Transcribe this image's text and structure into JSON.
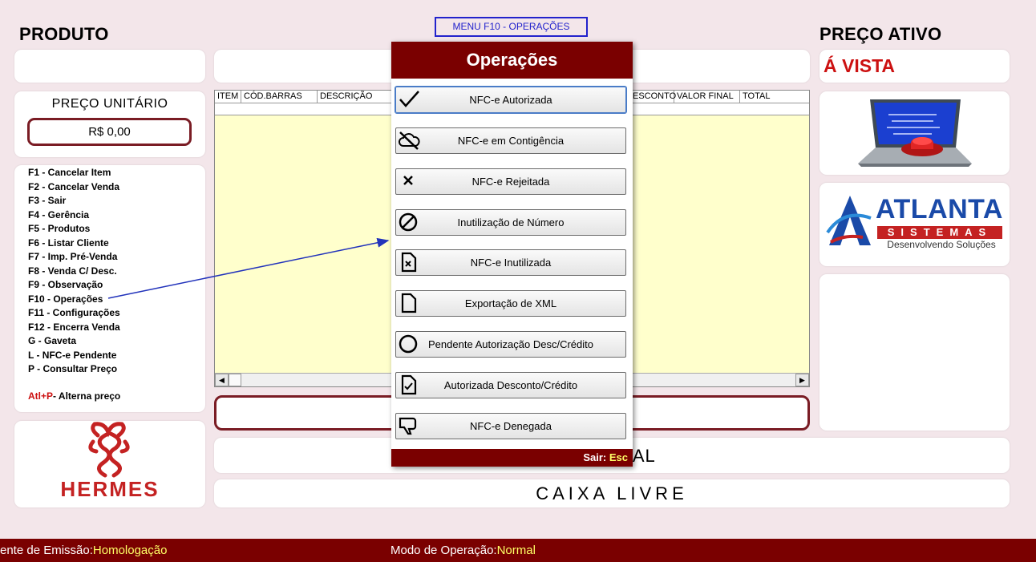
{
  "menu_label": "MENU F10 - OPERAÇÕES",
  "left": {
    "produto_title": "PRODUTO",
    "preco_unitario_title": "PREÇO UNITÁRIO",
    "preco_unitario_value": "R$ 0,00",
    "shortcuts": [
      "F1 - Cancelar Item",
      "F2 - Cancelar Venda",
      "F3 - Sair",
      "F4 - Gerência",
      "F5 - Produtos",
      "F6 - Listar Cliente",
      "F7 - Imp. Pré-Venda",
      "F8 - Venda C/ Desc.",
      "F9 - Observação",
      "F10 - Operações",
      "F11 - Configurações",
      "F12 - Encerra Venda",
      "G - Gaveta",
      "L - NFC-e Pendente",
      "P - Consultar Preço"
    ],
    "alt_key": "Atl+P",
    "alt_text": "- Alterna preço",
    "hermes_logo_text": "HERMES"
  },
  "grid": {
    "columns": [
      "ITEM",
      "CÓD.BARRAS",
      "DESCRIÇÃO",
      "ESCONTO",
      "VALOR FINAL",
      "TOTAL"
    ]
  },
  "center": {
    "valor_final": "OR FINAL",
    "caixa_livre": "CAIXA LIVRE"
  },
  "right": {
    "preco_ativo_title": "PREÇO ATIVO",
    "preco_ativo_value": "Á VISTA",
    "atlanta_name": "ATLANTA",
    "atlanta_sub": "SISTEMAS",
    "atlanta_slogan": "Desenvolvendo Soluções"
  },
  "modal": {
    "title": "Operações",
    "buttons": [
      {
        "label": "NFC-e Autorizada",
        "icon": "check-icon"
      },
      {
        "label": "NFC-e em Contigência",
        "icon": "cloud-off-icon"
      },
      {
        "label": "NFC-e Rejeitada",
        "icon": "x-icon"
      },
      {
        "label": "Inutilização de Número",
        "icon": "ban-icon"
      },
      {
        "label": "NFC-e Inutilizada",
        "icon": "file-x-icon"
      },
      {
        "label": "Exportação de XML",
        "icon": "file-icon"
      },
      {
        "label": "Pendente Autorização Desc/Crédito",
        "icon": "circle-icon"
      },
      {
        "label": "Autorizada Desconto/Crédito",
        "icon": "file-check-icon"
      },
      {
        "label": "NFC-e Denegada",
        "icon": "thumbs-down-icon"
      }
    ],
    "exit_label": "Sair:",
    "exit_key": "Esc"
  },
  "footer": {
    "ambiente_label": "ente de Emissão:",
    "ambiente_value": "Homologação",
    "modo_label": "Modo de Operação:",
    "modo_value": "Normal"
  },
  "colors": {
    "accent": "#7a0000",
    "background": "#f3e6ea",
    "grid_bg": "#ffffcc",
    "highlight": "#ffff66",
    "arrow": "#2233bb"
  }
}
